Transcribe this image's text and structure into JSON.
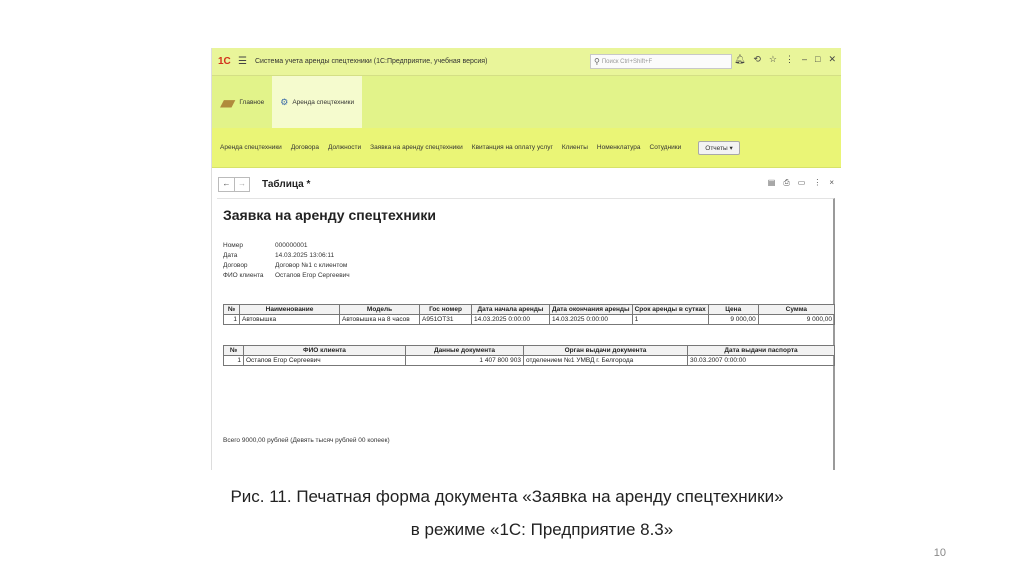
{
  "app": {
    "logo": "1С",
    "menu_icon": "hamburger-icon",
    "title": "Система учета аренды спецтехники  (1С:Предприятие, учебная версия)",
    "search_placeholder": "Поиск Ctrl+Shift+F",
    "toolbar_icons": [
      "bell-icon",
      "history-icon",
      "star-icon",
      "more-icon",
      "minimize-icon",
      "maximize-icon",
      "close-icon"
    ]
  },
  "sections": [
    {
      "label": "Главное",
      "icon": "home-icon"
    },
    {
      "label": "Аренда спецтехники",
      "icon": "machinery-icon"
    }
  ],
  "nav": {
    "items": [
      "Аренда спецтехники",
      "Договора",
      "Должности",
      "Заявка на аренду спецтехники",
      "Квитанция на оплату услуг",
      "Клиенты",
      "Номенклатура",
      "Сотудники"
    ],
    "reports": "Отчеты ▾"
  },
  "doc": {
    "back": "←",
    "forward": "→",
    "title": "Таблица *",
    "tools": [
      "save-icon",
      "print-icon",
      "preview-icon",
      "more-icon",
      "close-icon"
    ]
  },
  "form": {
    "title": "Заявка на аренду спецтехники",
    "fields": [
      {
        "label": "Номер",
        "value": "000000001"
      },
      {
        "label": "Дата",
        "value": "14.03.2025 13:06:11"
      },
      {
        "label": "Договор",
        "value": "Договор №1 с клиентом"
      },
      {
        "label": "ФИО клиента",
        "value": "Остапов Егор Сергеевич"
      }
    ],
    "table1": {
      "headers": [
        "№",
        "Наименование",
        "Модель",
        "Гос номер",
        "Дата начала аренды",
        "Дата окончания аренды",
        "Срок аренды в сутках",
        "Цена",
        "Сумма"
      ],
      "rows": [
        [
          "1",
          "Автовышка",
          "Автовышка на 8 часов",
          "А951ОТ31",
          "14.03.2025 0:00:00",
          "14.03.2025 0:00:00",
          "1",
          "9 000,00",
          "9 000,00"
        ]
      ]
    },
    "table2": {
      "headers": [
        "№",
        "ФИО клиента",
        "Данные документа",
        "Орган выдачи документа",
        "Дата выдачи паспорта"
      ],
      "rows": [
        [
          "1",
          "Остапов Егор Сергеевич",
          "1 407 800 903",
          "отделением №1 УМВД г. Белгорода",
          "30.03.2007 0:00:00"
        ]
      ]
    },
    "total": "Всего 9000,00 рублей (Девять тысяч рублей 00 копеек)"
  },
  "caption": {
    "line1": "Рис. 11. Печатная форма документа «Заявка на аренду спецтехники»",
    "line2": "в режиме «1С: Предприятие 8.3»"
  },
  "page_number": "10"
}
